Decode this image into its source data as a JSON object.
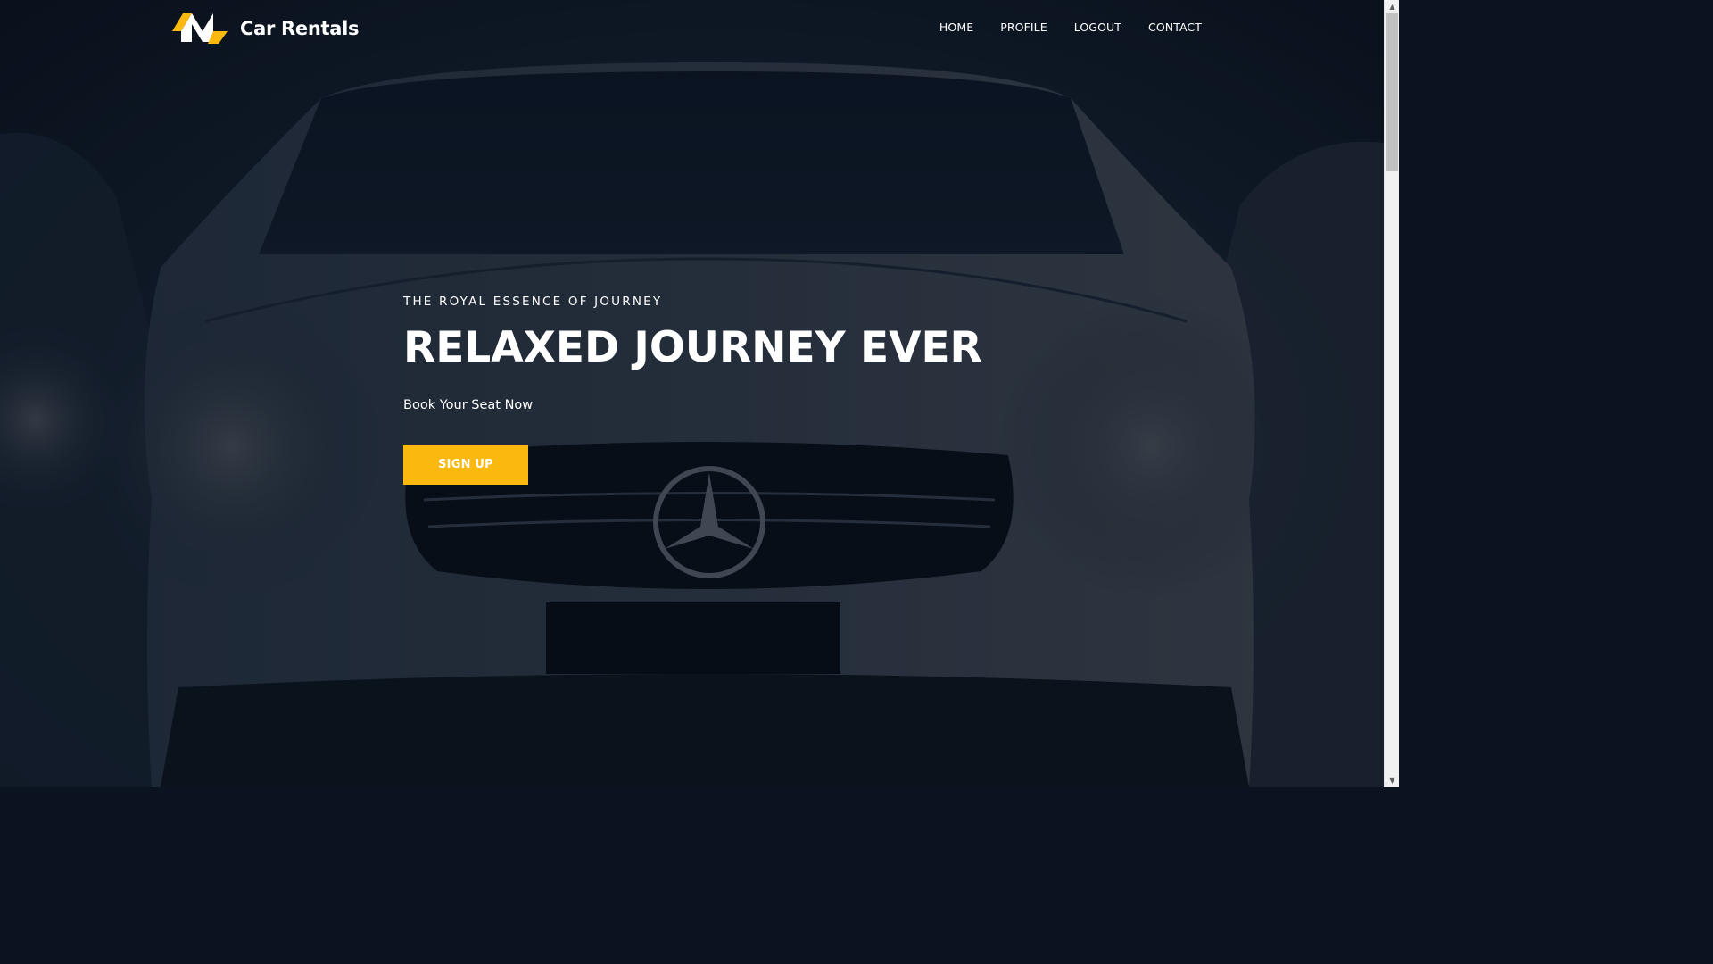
{
  "brand": {
    "name": "Car Rentals",
    "logo_icon": "car-rentals-logo-icon",
    "accent_color": "#fbb80f"
  },
  "nav": {
    "items": [
      {
        "label": "HOME"
      },
      {
        "label": "PROFILE"
      },
      {
        "label": "LOGOUT"
      },
      {
        "label": "CONTACT"
      }
    ]
  },
  "hero": {
    "eyebrow": "THE ROYAL ESSENCE OF JOURNEY",
    "headline": "RELAXED JOURNEY EVER",
    "subtext": "Book Your Seat Now",
    "cta_label": "SIGN UP",
    "cta_color": "#fbb80f",
    "background": "mercedes-car-front-photo"
  },
  "scrollbar": {
    "up_icon": "▲",
    "down_icon": "▼"
  }
}
